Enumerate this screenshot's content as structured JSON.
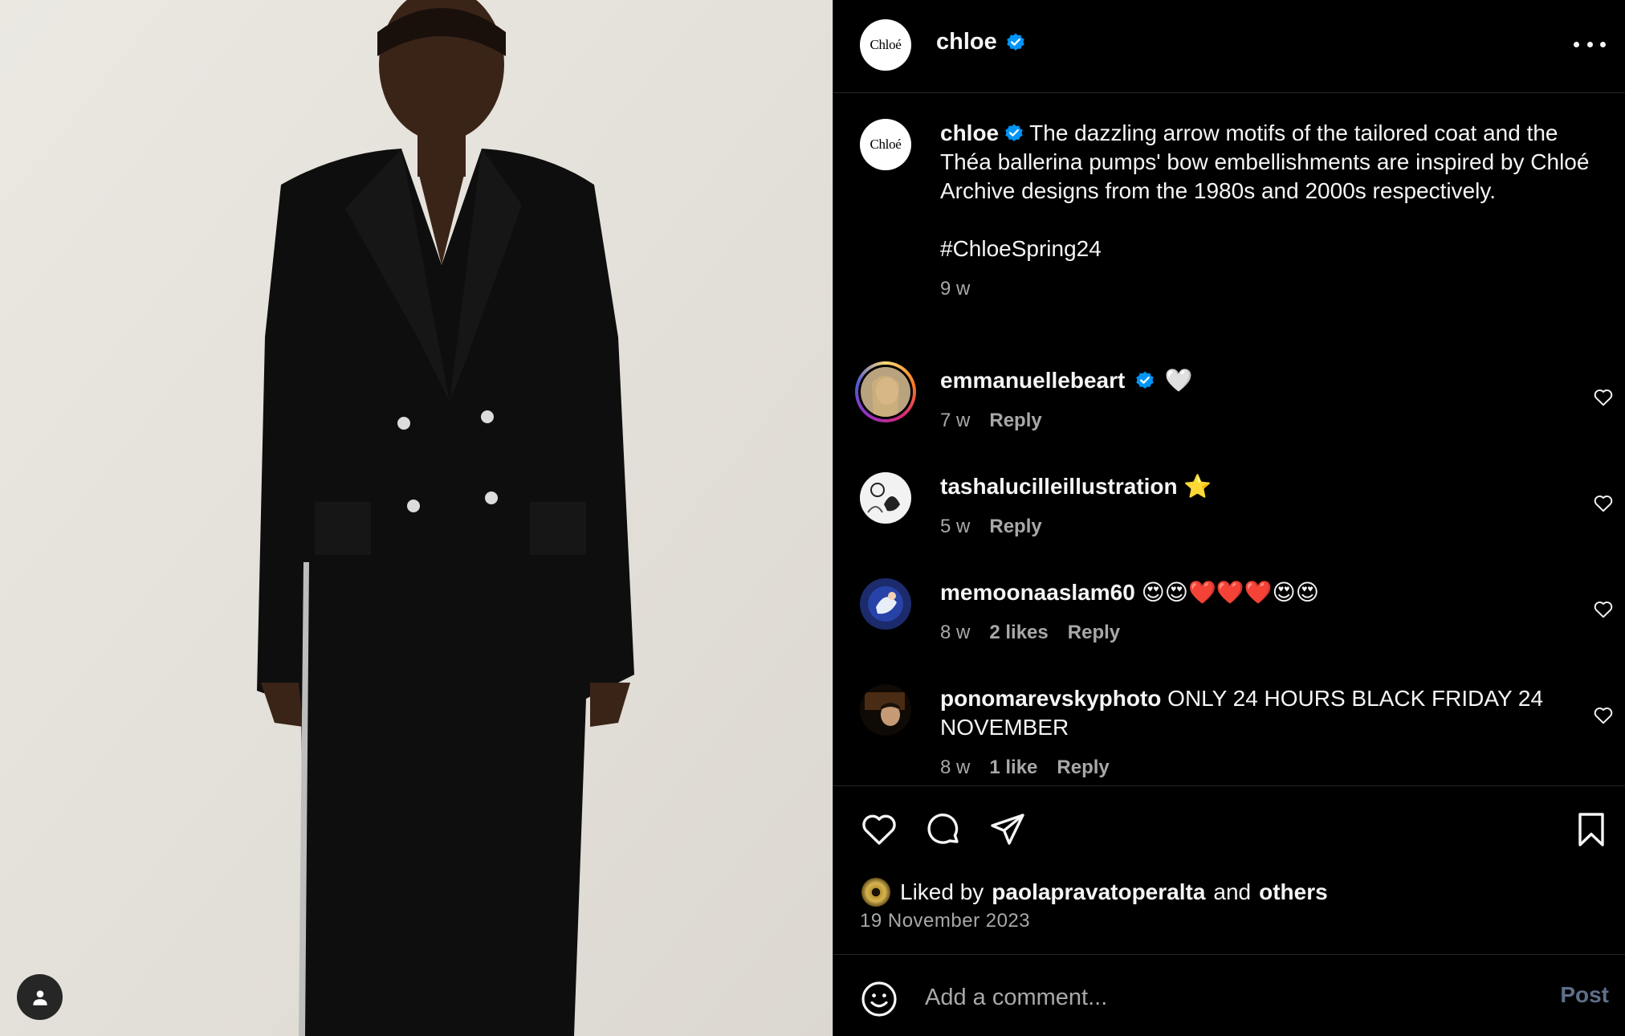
{
  "post": {
    "account": "chloe",
    "logo_text": "Chloé",
    "caption": "The dazzling arrow motifs of the tailored coat and the Théa ballerina pumps' bow embellishments are inspired by Chloé Archive designs from the 1980s and 2000s respectively.",
    "hashtag": "#ChloeSpring24",
    "caption_age": "9 w",
    "image_icon": "user-tag-icon"
  },
  "comments": [
    {
      "username": "emmanuellebeart",
      "verified": true,
      "text": "🤍",
      "age": "7 w",
      "likes": "",
      "reply": "Reply"
    },
    {
      "username": "tashalucilleillustration",
      "verified": false,
      "text": "⭐",
      "age": "5 w",
      "likes": "",
      "reply": "Reply"
    },
    {
      "username": "memoonaaslam60",
      "verified": false,
      "text": "😍😍❤️❤️❤️😍😍",
      "age": "8 w",
      "likes": "2 likes",
      "reply": "Reply"
    },
    {
      "username": "ponomarevskyphoto",
      "verified": false,
      "text": "ONLY 24 HOURS BLACK FRIDAY 24 NOVEMBER",
      "age": "8 w",
      "likes": "1 like",
      "reply": "Reply"
    }
  ],
  "likes": {
    "prefix": "Liked by",
    "user": "paolapravatoperalta",
    "joiner": "and",
    "others": "others",
    "date": "19 November 2023"
  },
  "comment_box": {
    "placeholder": "Add a comment...",
    "post_label": "Post"
  },
  "colors": {
    "background": "#000000",
    "verified": "#0095f6",
    "secondary_text": "#a8a8a8",
    "post_button_disabled": "#5f6f8a"
  }
}
